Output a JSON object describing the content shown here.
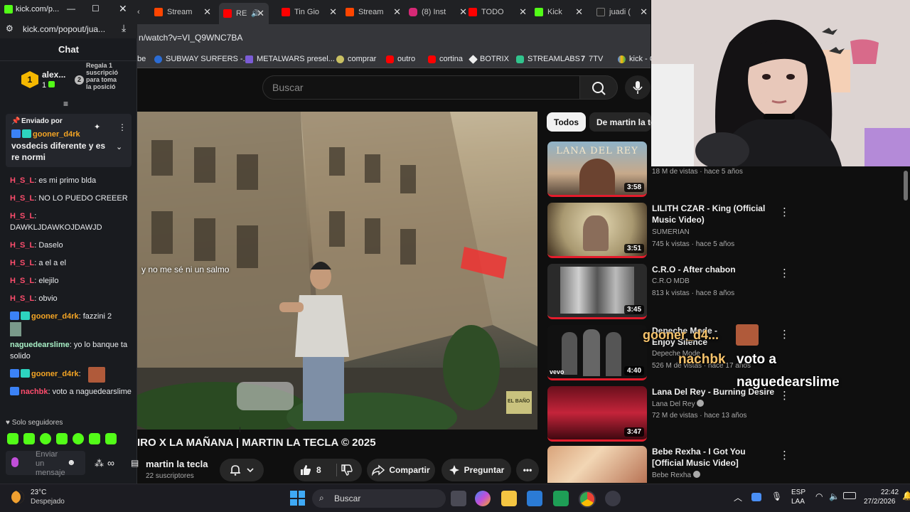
{
  "kick": {
    "window_title": "kick.com/p...",
    "url": "kick.com/popout/jua...",
    "chat_title": "Chat",
    "sub_leader": {
      "name": "alex...",
      "count": "1",
      "rank": "1"
    },
    "gift_prompt": "Regala 1 suscripció para toma la posició",
    "gift_rank": "2",
    "pinned": {
      "header": "Enviado por",
      "user": "gooner_d4rk",
      "text": "vosdecis diferente y es re normi"
    },
    "messages": [
      {
        "user": "H_S_L",
        "text": ": es mi primo blda"
      },
      {
        "user": "H_S_L",
        "text": ": NO LO PUEDO CREEER"
      },
      {
        "user": "H_S_L",
        "text": ":"
      },
      {
        "user": "",
        "text": "DAWKLJDAWKOJDAWJD"
      },
      {
        "user": "H_S_L",
        "text": ": Daselo"
      },
      {
        "user": "H_S_L",
        "text": ": a el a el"
      },
      {
        "user": "H_S_L",
        "text": ": elejilo"
      },
      {
        "user": "H_S_L",
        "text": ": obvio"
      },
      {
        "user": "gooner_d4rk",
        "text": ": fazzini 2"
      },
      {
        "user": "naguedearslime",
        "text": ": yo lo banque ta solido"
      },
      {
        "user": "gooner_d4rk",
        "text": ":"
      },
      {
        "user": "nachbk",
        "text": ": voto a naguedearslime"
      }
    ],
    "followers_only": "Solo seguidores",
    "send_placeholder": "Enviar un mensaje"
  },
  "browser": {
    "tabs": [
      {
        "label": "Stream",
        "color": "#ff4500"
      },
      {
        "label": "RE",
        "color": "#ff0000"
      },
      {
        "label": "Tin Gio",
        "color": "#ff0000"
      },
      {
        "label": "Stream",
        "color": "#ff4500"
      },
      {
        "label": "(8) Inst",
        "color": "#d62976"
      },
      {
        "label": "TODO",
        "color": "#ff0000"
      },
      {
        "label": "Kick",
        "color": "#53fc18"
      },
      {
        "label": "juadi (",
        "color": "#222222"
      }
    ],
    "url": "n/watch?v=VI_Q9WNC7BA",
    "bookmarks": [
      "be",
      "SUBWAY SURFERS -...",
      "METALWARS presel...",
      "comprar",
      "outro",
      "cortina",
      "BOTRIX",
      "STREAMLABS",
      "7TV",
      "kick - C"
    ]
  },
  "youtube": {
    "search_placeholder": "Buscar",
    "video_caption": "y no me sé ni un salmo",
    "video_sign": "EL BAÑO",
    "video_title": "IRO X LA MAÑANA | MARTIN LA TECLA © 2025",
    "channel": "martin la tecla",
    "subscribers": "22 suscriptores",
    "likes": "8",
    "share": "Compartir",
    "ask": "Preguntar",
    "chips": [
      "Todos",
      "De martin la tec"
    ],
    "recommendations": [
      {
        "title": "",
        "channel": "",
        "meta": "18 M de vistas · hace 5 años",
        "duration": "3:58",
        "thumb_text": "LANA DEL REY"
      },
      {
        "title": "LILITH CZAR - King (Official Music Video)",
        "channel": "SUMERIAN",
        "meta": "745 k vistas · hace 5 años",
        "duration": "3:51"
      },
      {
        "title": "C.R.O - After chabon",
        "channel": "C.R.O MDB",
        "meta": "813 k vistas · hace 8 años",
        "duration": "3:45"
      },
      {
        "title": "Depeche Mode - Enjoy Silence",
        "channel": "Depeche Mode",
        "meta": "526 M de vistas · hace 17 años",
        "duration": "4:40",
        "thumb_text": "vevo"
      },
      {
        "title": "Lana Del Rey - Burning Desire",
        "channel": "Lana Del Rey",
        "meta": "72 M de vistas · hace 13 años",
        "duration": "3:47"
      },
      {
        "title": "Bebe Rexha - I Got You [Official Music Video]",
        "channel": "Bebe Rexha",
        "meta": "",
        "duration": ""
      }
    ]
  },
  "overlay": {
    "user1": "gooner_d4...",
    "user2": "nachbk",
    "text": "voto a",
    "text2": "naguedearslime"
  },
  "taskbar": {
    "temperature": "23°C",
    "weather": "Despejado",
    "search": "Buscar",
    "lang1": "ESP",
    "lang2": "LAA",
    "time": "22:42",
    "date": "27/2/2026"
  },
  "colors": {
    "kick_green": "#53fc18",
    "hsl_red": "#ff4d6d",
    "gooner_orange": "#f5a524",
    "nague_green": "#a8f0c6",
    "yt_red": "#ff0000"
  }
}
